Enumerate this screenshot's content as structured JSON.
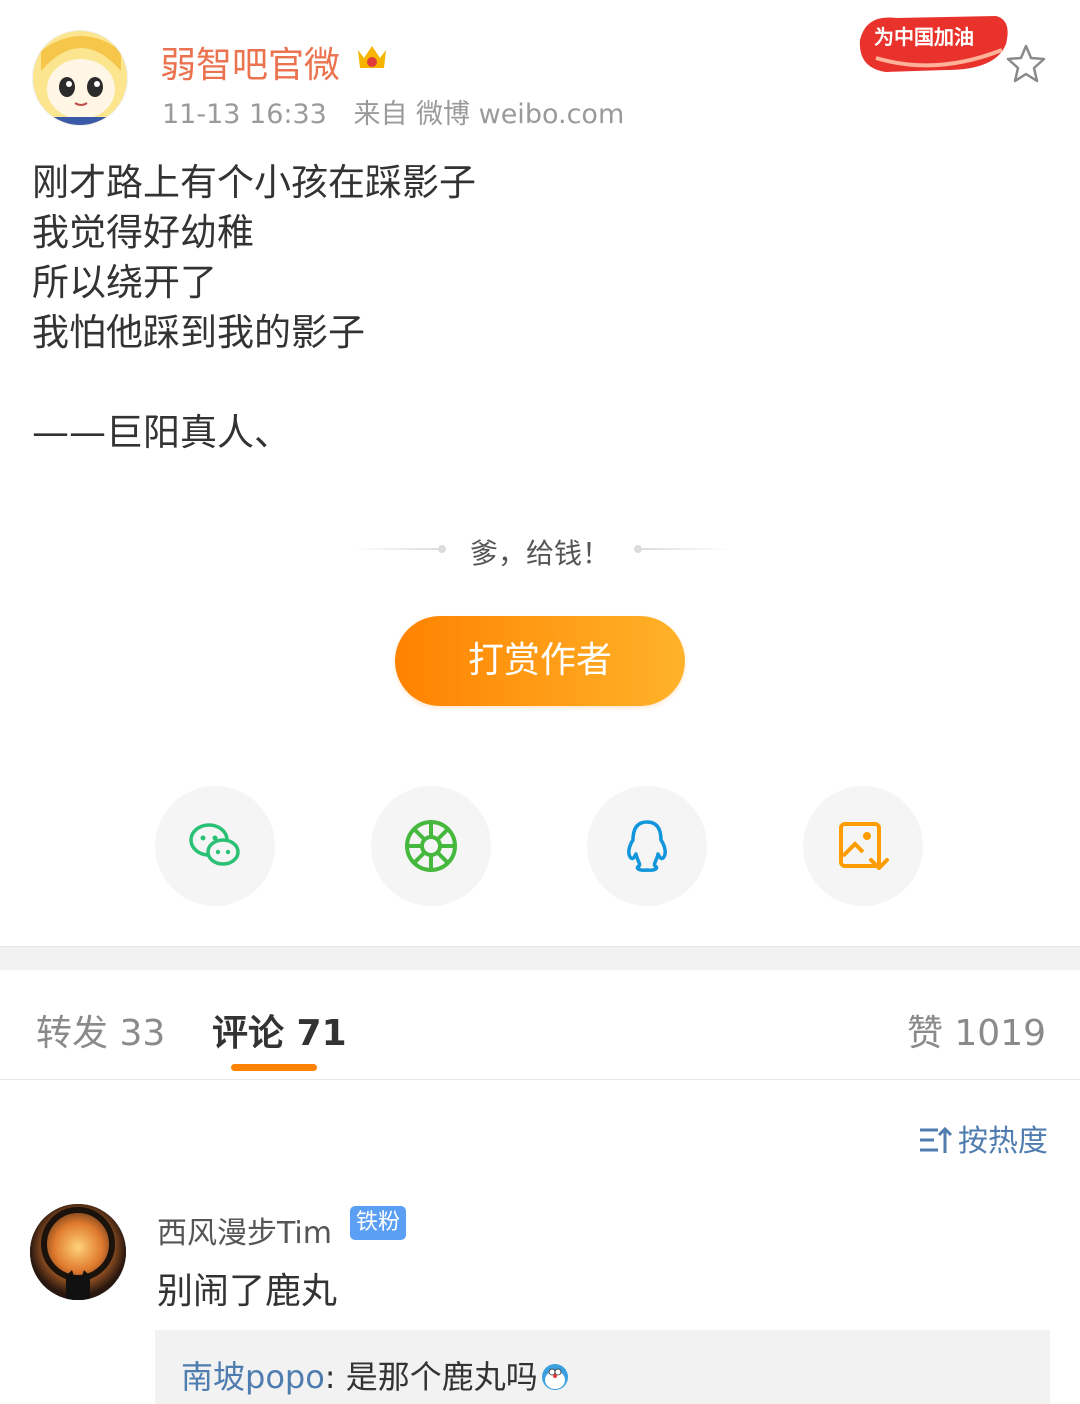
{
  "post_header": {
    "username": "弱智吧官微",
    "timestamp": "11-13 16:33",
    "source": "来自 微博 weibo.com",
    "promo_badge": "为中国加油"
  },
  "post": {
    "lines": [
      "刚才路上有个小孩在踩影子",
      "我觉得好幼稚",
      "所以绕开了",
      "我怕他踩到我的影子"
    ],
    "signature": "——巨阳真人、"
  },
  "reward": {
    "slogan": "爹，给钱！",
    "button_label": "打赏作者"
  },
  "share": {
    "items": [
      "wechat-icon",
      "moments-icon",
      "qq-icon",
      "save-image-icon"
    ]
  },
  "tabs": {
    "repost": "转发 33",
    "comments": "评论 71",
    "likes": "赞 1019"
  },
  "sort": {
    "label": "按热度"
  },
  "comments": [
    {
      "name": "西风漫步Tim",
      "badge": "铁粉",
      "text": "别闹了鹿丸",
      "reply_user": "南坡popo",
      "reply_sep": ": ",
      "reply_text": "是那个鹿丸吗"
    }
  ],
  "colors": {
    "username": "#eb7350",
    "accent": "#ff8200",
    "link": "#507daf",
    "badge": "#5b9ff5"
  }
}
